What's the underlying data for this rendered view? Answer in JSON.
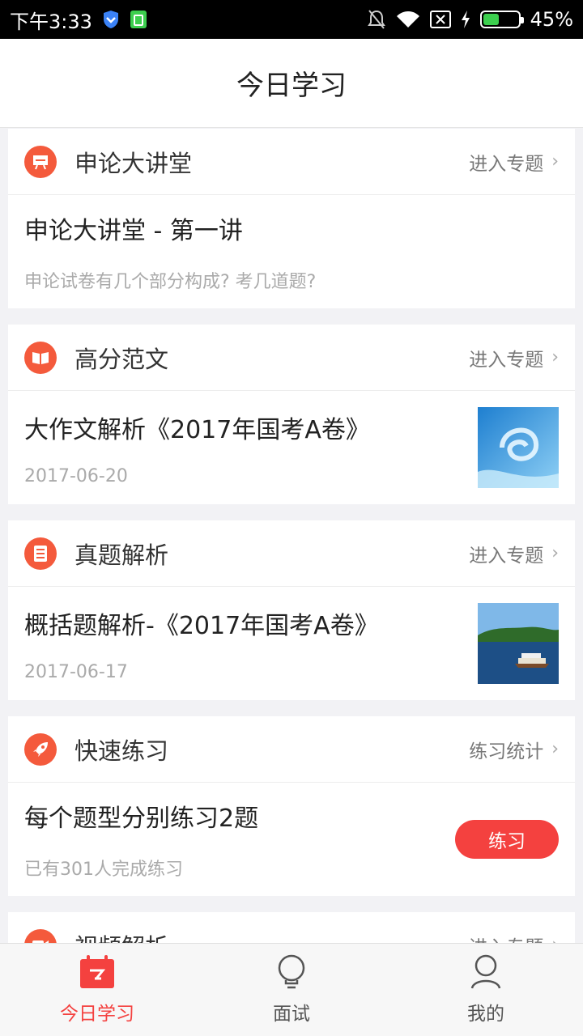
{
  "status_bar": {
    "time": "下午3:33",
    "battery": "45%",
    "battery_level": 0.45
  },
  "header": {
    "title": "今日学习"
  },
  "sections": [
    {
      "title": "申论大讲堂",
      "link": "进入专题",
      "icon": "presentation-icon",
      "item": {
        "title": "申论大讲堂 - 第一讲",
        "subtitle": "申论试卷有几个部分构成? 考几道题?"
      }
    },
    {
      "title": "高分范文",
      "link": "进入专题",
      "icon": "book-icon",
      "item": {
        "title": "大作文解析《2017年国考A卷》",
        "subtitle": "2017-06-20",
        "thumbnail": "water-splash-image"
      }
    },
    {
      "title": "真题解析",
      "link": "进入专题",
      "icon": "document-icon",
      "item": {
        "title": "概括题解析-《2017年国考A卷》",
        "subtitle": "2017-06-17",
        "thumbnail": "lake-boat-image"
      }
    },
    {
      "title": "快速练习",
      "link": "练习统计",
      "icon": "rocket-icon",
      "item": {
        "title": "每个题型分别练习2题",
        "subtitle": "已有301人完成练习",
        "button": "练习"
      }
    },
    {
      "title": "视频解析",
      "link": "进入专题",
      "icon": "video-icon"
    }
  ],
  "tabs": [
    {
      "label": "今日学习",
      "icon": "calendar-icon",
      "active": true
    },
    {
      "label": "面试",
      "icon": "lightbulb-icon",
      "active": false
    },
    {
      "label": "我的",
      "icon": "user-icon",
      "active": false
    }
  ],
  "colors": {
    "accent": "#f4413f",
    "icon_bg": "#f45a3c"
  }
}
